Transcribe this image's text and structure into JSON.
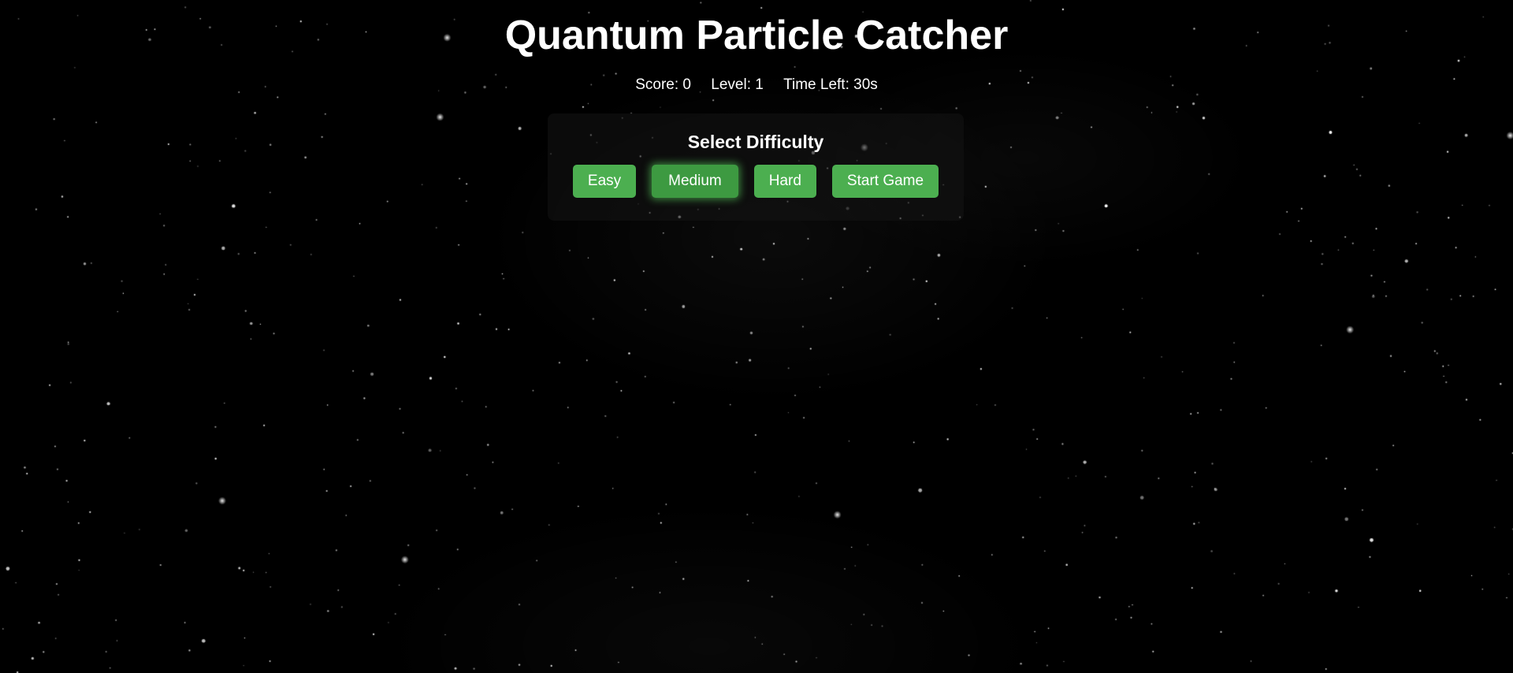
{
  "title": "Quantum Particle Catcher",
  "stats": {
    "score_label": "Score: 0",
    "level_label": "Level: 1",
    "time_label": "Time Left: 30s"
  },
  "difficulty": {
    "heading": "Select Difficulty",
    "selected": "Medium",
    "buttons": {
      "easy": "Easy",
      "medium": "Medium",
      "hard": "Hard",
      "start": "Start Game"
    }
  },
  "colors": {
    "background": "#000000",
    "button": "#4caf50",
    "button_selected": "#3d9a41",
    "text": "#ffffff"
  }
}
